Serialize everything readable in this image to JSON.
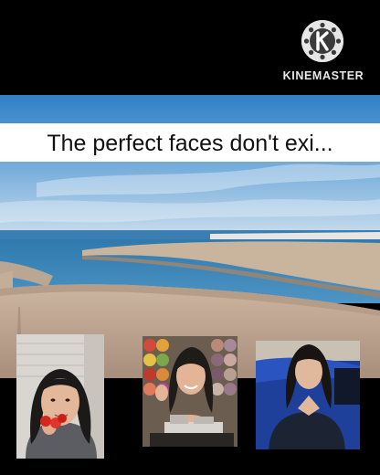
{
  "watermark": {
    "brand_name": "KINEMASTER",
    "icon": "kinemaster-logo-icon"
  },
  "caption": {
    "text": "The perfect faces don't exi..."
  },
  "scene": {
    "description_icon": "seaside-landscape-photo"
  },
  "faces": [
    {
      "icon": "person-photo-strawberry"
    },
    {
      "icon": "person-photo-yarn-wall"
    },
    {
      "icon": "person-photo-blue-car"
    }
  ],
  "colors": {
    "sky_top": "#2f7fc6",
    "sky_bottom": "#cfe0ee",
    "sea": "#3f86b9",
    "caption_bg": "#ffffff",
    "caption_text": "#111111"
  }
}
